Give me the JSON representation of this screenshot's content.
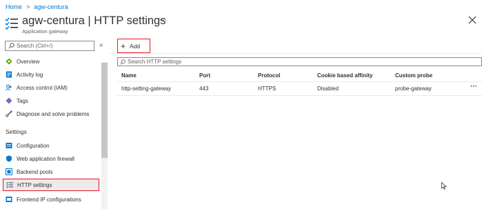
{
  "breadcrumb": {
    "home": "Home",
    "separator": ">",
    "resource": "agw-centura"
  },
  "header": {
    "title": "agw-centura | HTTP settings",
    "subtitle": "Application gateway",
    "more": "···",
    "icon": "list-settings-icon",
    "close_icon": "close-icon"
  },
  "sidebar": {
    "search_placeholder": "Search (Ctrl+/)",
    "collapse": "«",
    "items": [
      {
        "label": "Overview",
        "icon": "overview-diamond-icon",
        "color": "#57a300"
      },
      {
        "label": "Activity log",
        "icon": "activity-log-icon",
        "color": "#0078d4"
      },
      {
        "label": "Access control (IAM)",
        "icon": "people-icon",
        "color": "#0078d4"
      },
      {
        "label": "Tags",
        "icon": "tag-icon",
        "color": "#8661c5"
      },
      {
        "label": "Diagnose and solve problems",
        "icon": "wrench-icon",
        "color": "#605e5c"
      }
    ],
    "section_settings": "Settings",
    "settings_items": [
      {
        "label": "Configuration",
        "icon": "configuration-icon",
        "color": "#0078d4"
      },
      {
        "label": "Web application firewall",
        "icon": "shield-icon",
        "color": "#0078d4"
      },
      {
        "label": "Backend pools",
        "icon": "backend-pool-icon",
        "color": "#0078d4"
      },
      {
        "label": "HTTP settings",
        "icon": "list-settings-icon",
        "color": "#0078d4",
        "selected": true
      },
      {
        "label": "Frontend IP configurations",
        "icon": "frontend-ip-icon",
        "color": "#0078d4"
      }
    ]
  },
  "toolbar": {
    "add_label": "Add",
    "add_icon": "plus-icon"
  },
  "table_search": {
    "placeholder": "Search HTTP settings"
  },
  "table": {
    "columns": [
      "Name",
      "Port",
      "Protocol",
      "Cookie based affinity",
      "Custom probe"
    ],
    "rows": [
      {
        "name": "http-setting-gateway",
        "port": "443",
        "protocol": "HTTPS",
        "affinity": "Disabled",
        "probe": "probe-gateway",
        "more": "···"
      }
    ]
  },
  "colors": {
    "accent": "#0078d4",
    "highlight_border": "#e81123",
    "selected_bg": "#edebe9"
  }
}
